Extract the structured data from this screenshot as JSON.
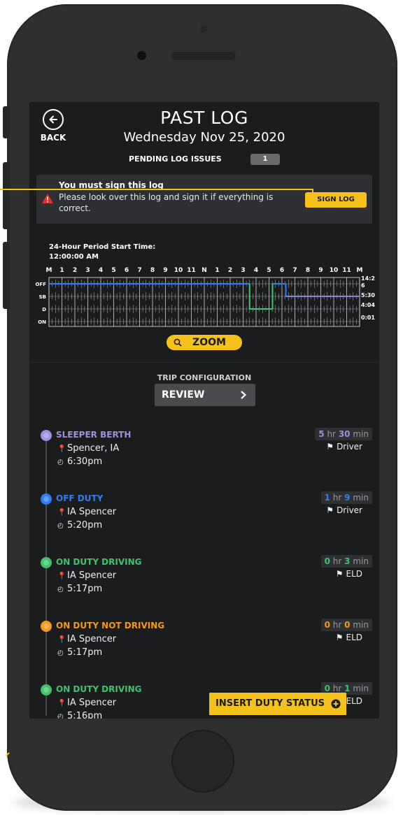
{
  "header": {
    "back_label": "BACK",
    "title": "PAST LOG",
    "date": "Wednesday Nov 25, 2020",
    "pending_label": "PENDING LOG ISSUES",
    "pending_count": "1"
  },
  "alert": {
    "title": "You must sign this log",
    "message": "Please look over this log and sign it if everything is correct.",
    "button": "SIGN LOG"
  },
  "log_graph": {
    "period_label": "24-Hour Period Start Time:",
    "period_time": "12:00:00 AM",
    "hour_labels": [
      "M",
      "1",
      "2",
      "3",
      "4",
      "5",
      "6",
      "7",
      "8",
      "9",
      "10",
      "11",
      "N",
      "1",
      "2",
      "3",
      "4",
      "5",
      "6",
      "7",
      "8",
      "9",
      "10",
      "11",
      "M"
    ],
    "rows": [
      "OFF",
      "SB",
      "D",
      "ON"
    ],
    "totals": [
      "14:2",
      "6",
      "5:30",
      "4:04",
      "0:01"
    ],
    "colors": {
      "off": "#2e7ff5",
      "sb": "#8b86d8",
      "d": "#3fc36b",
      "on": "#f39a1c"
    }
  },
  "zoom_label": "ZOOM",
  "trip": {
    "label": "TRIP CONFIGURATION",
    "button": "REVIEW"
  },
  "entries": [
    {
      "status": "SLEEPER BERTH",
      "color": "#9a93e0",
      "location": "Spencer, IA",
      "time": "6:30pm",
      "hr": "5",
      "min": "30",
      "source": "Driver"
    },
    {
      "status": "OFF DUTY",
      "color": "#2e7ff5",
      "location": "IA Spencer",
      "time": "5:20pm",
      "hr": "1",
      "min": "9",
      "source": "Driver"
    },
    {
      "status": "ON DUTY DRIVING",
      "color": "#3fc36b",
      "location": "IA Spencer",
      "time": "5:17pm",
      "hr": "0",
      "min": "3",
      "source": "ELD"
    },
    {
      "status": "ON DUTY NOT DRIVING",
      "color": "#f39a1c",
      "location": "IA Spencer",
      "time": "5:17pm",
      "hr": "0",
      "min": "0",
      "source": "ELD"
    },
    {
      "status": "ON DUTY DRIVING",
      "color": "#3fc36b",
      "location": "IA Spencer",
      "time": "5:16pm",
      "hr": "0",
      "min": "1",
      "source": "ELD"
    }
  ],
  "units": {
    "hr": "hr",
    "min": "min"
  },
  "insert_button": "INSERT DUTY STATUS",
  "icons": [
    "back-arrow-icon",
    "warning-icon",
    "zoom-icon",
    "chevron-right-icon",
    "location-pin-icon",
    "clock-icon",
    "flag-icon",
    "plus-circle-icon"
  ]
}
